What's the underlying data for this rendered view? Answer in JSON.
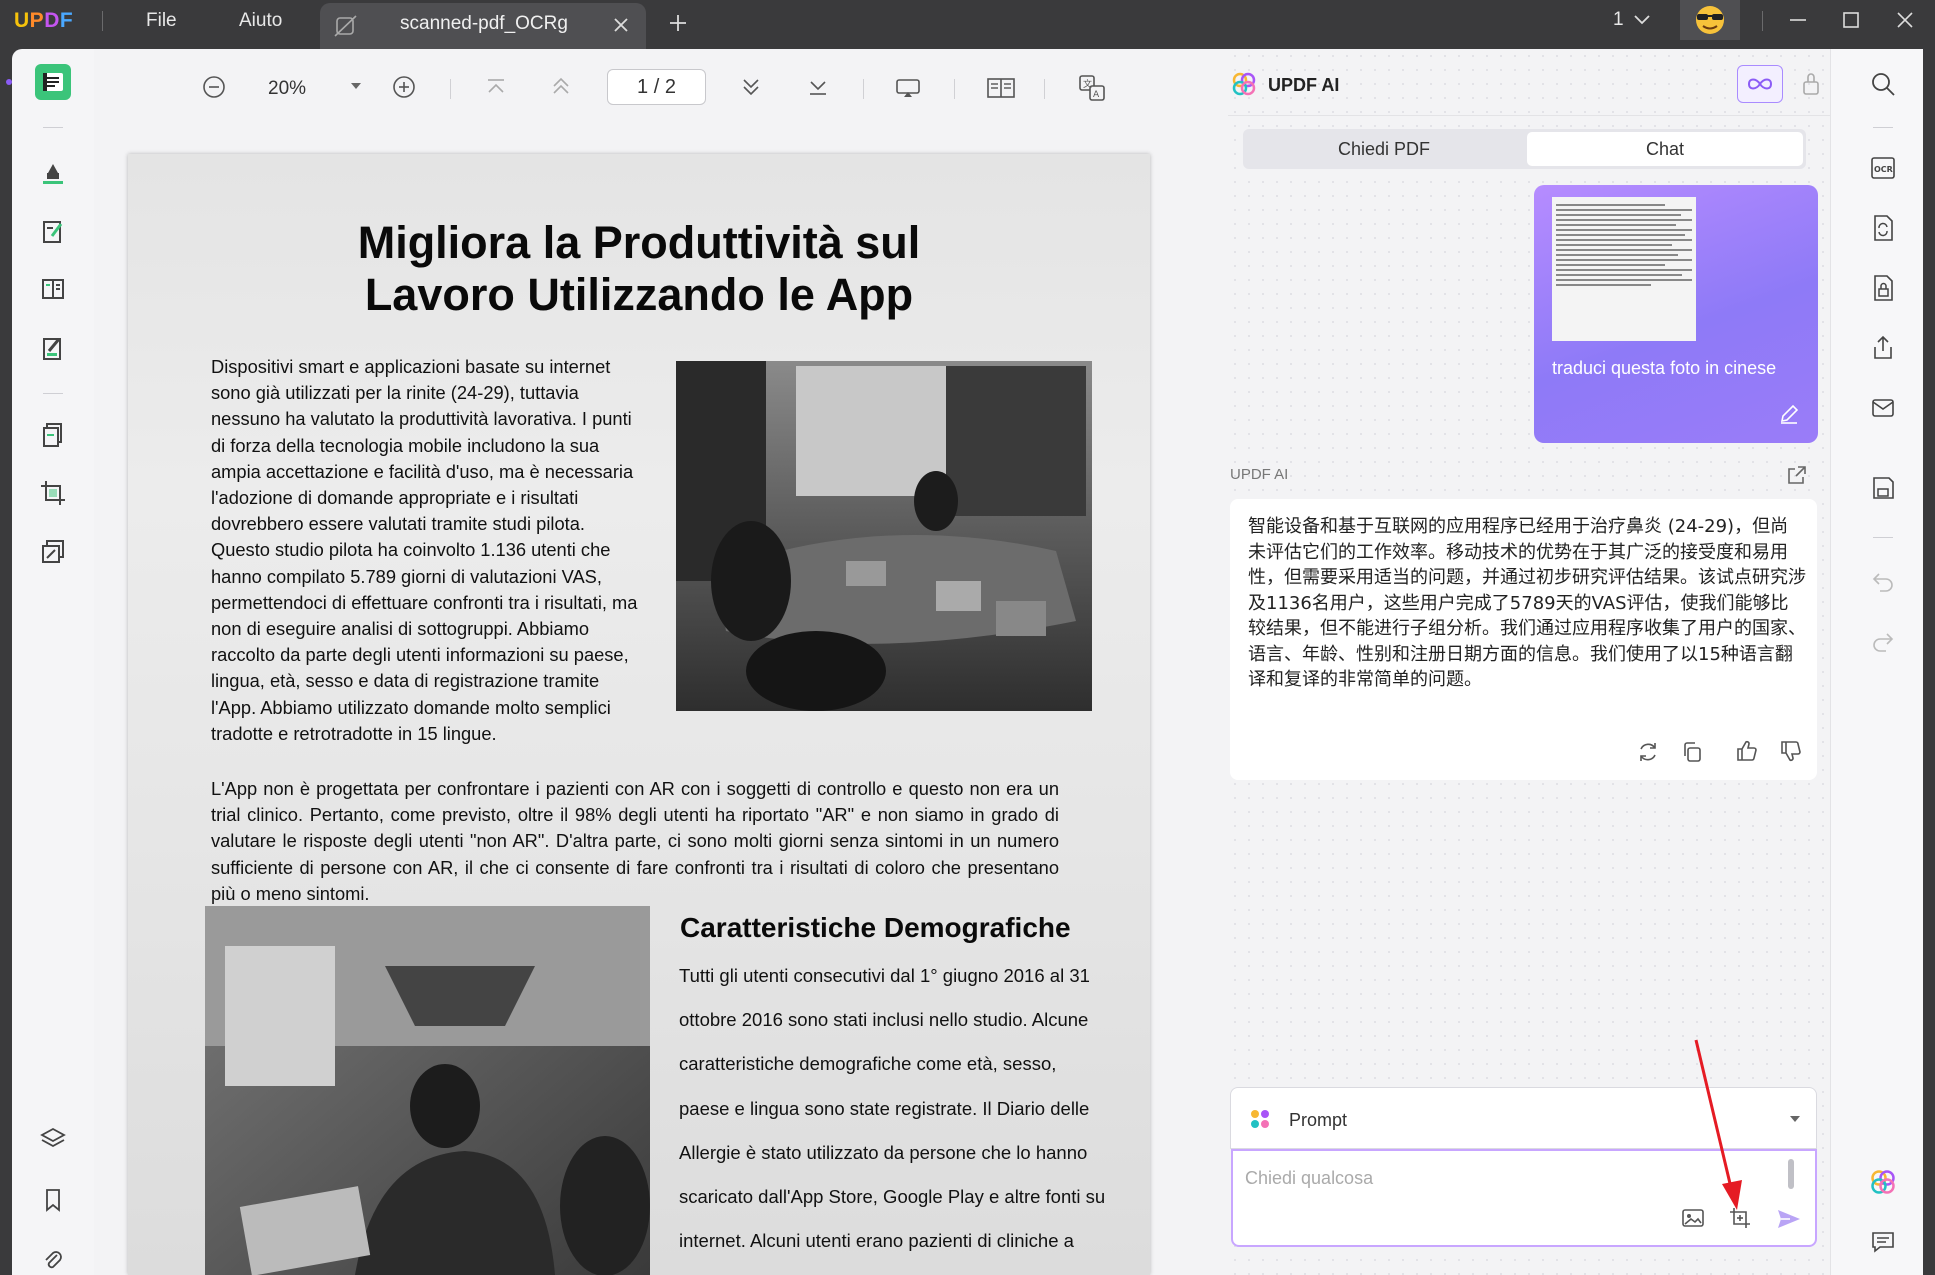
{
  "app": {
    "brand": "UPDF"
  },
  "menu": {
    "file": "File",
    "help": "Aiuto"
  },
  "tab": {
    "title": "scanned-pdf_OCRg"
  },
  "window": {
    "count": "1"
  },
  "doc_toolbar": {
    "zoom": "20%",
    "page_current": "1",
    "page_sep": "/",
    "page_total": "2"
  },
  "page": {
    "title_line1": "Migliora la Produttività sul",
    "title_line2": "Lavoro Utilizzando le App",
    "col1": "Dispositivi smart e applicazioni basate su internet sono già utilizzati per la rinite (24-29), tuttavia nessuno ha valutato la produttività lavorativa. I punti di forza della tecnologia mobile includono la sua ampia accettazione e facilità d'uso, ma è necessaria l'adozione di domande appropriate e i risultati dovrebbero essere valutati tramite studi pilota. Questo studio pilota ha coinvolto 1.136 utenti che hanno compilato 5.789 giorni di valutazioni VAS, permettendoci di effettuare confronti tra i risultati, ma non di eseguire analisi di sottogruppi. Abbiamo raccolto da parte degli utenti informazioni su paese, lingua, età, sesso e data di registrazione tramite l'App. Abbiamo utilizzato domande molto semplici tradotte e retrotradotte in 15 lingue.",
    "para2": "L'App non è progettata per confrontare i pazienti con AR con i soggetti di controllo e questo non era un trial clinico. Pertanto, come previsto, oltre il 98% degli utenti ha riportato \"AR\" e non siamo in grado di valutare le risposte degli utenti \"non AR\". D'altra parte, ci sono molti giorni senza sintomi in un numero sufficiente di persone con AR, il che ci consente di fare confronti tra i risultati di coloro che presentano più o meno sintomi.",
    "subheading": "Caratteristiche Demografiche",
    "col2": "Tutti gli utenti consecutivi dal 1° giugno 2016 al 31 ottobre 2016 sono stati inclusi nello studio. Alcune caratteristiche demografiche come età, sesso, paese e lingua sono state registrate. Il Diario delle Allergie è stato utilizzato da persone che lo hanno scaricato dall'App Store, Google Play e altre fonti su internet. Alcuni utenti erano pazienti di cliniche a"
  },
  "ai": {
    "title": "UPDF AI",
    "tab_ask_pdf": "Chiedi PDF",
    "tab_chat": "Chat",
    "user_message": "traduci questa foto in cinese",
    "assistant_label": "UPDF AI",
    "answer": "智能设备和基于互联网的应用程序已经用于治疗鼻炎 (24-29)，但尚未评估它们的工作效率。移动技术的优势在于其广泛的接受度和易用性，但需要采用适当的问题，并通过初步研究评估结果。该试点研究涉及1136名用户，这些用户完成了5789天的VAS评估，使我们能够比较结果，但不能进行子组分析。我们通过应用程序收集了用户的国家、语言、年龄、性别和注册日期方面的信息。我们使用了以15种语言翻译和复译的非常简单的问题。",
    "prompt_label": "Prompt",
    "input_placeholder": "Chiedi qualcosa"
  },
  "colors": {
    "accent": "#8b5cf6",
    "brand_green": "#3bc47a",
    "annotation_arrow": "#e51b24"
  }
}
